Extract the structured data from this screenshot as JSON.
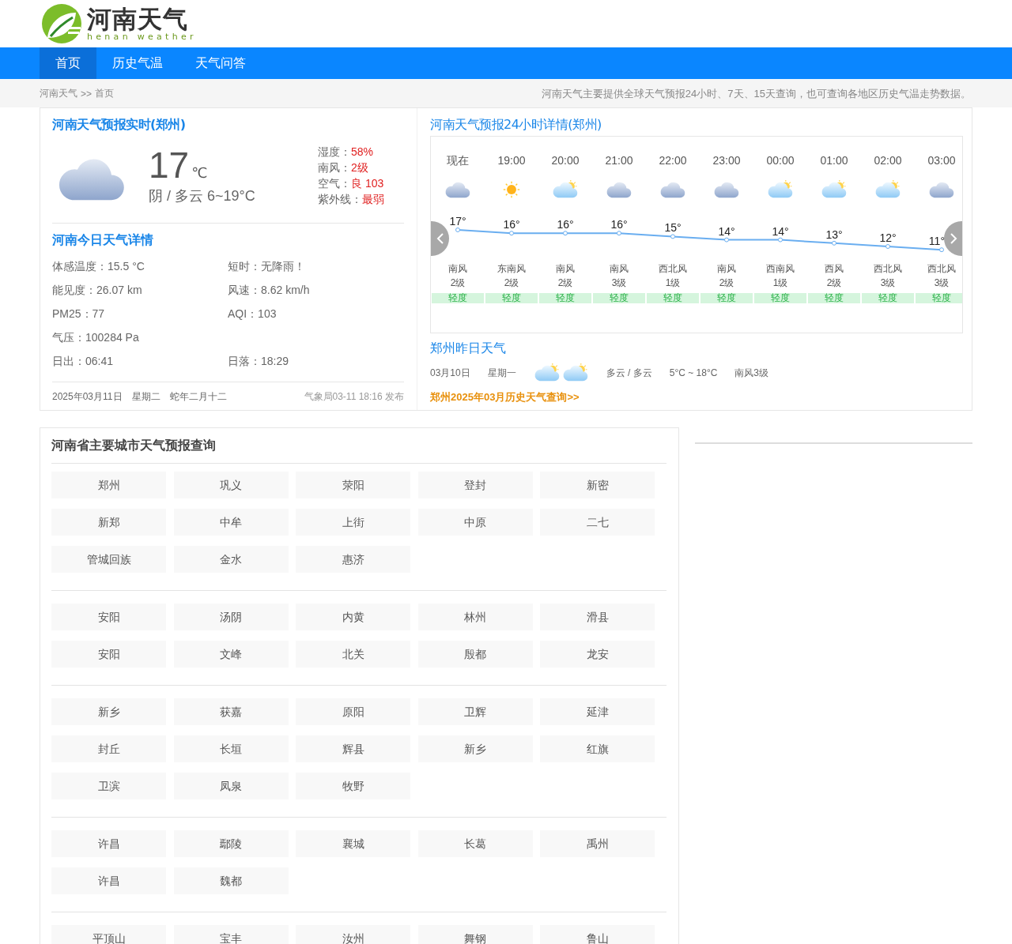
{
  "logo": {
    "title": "河南天气",
    "subtitle": "henan weather"
  },
  "nav": [
    {
      "label": "首页",
      "selected": true
    },
    {
      "label": "历史气温",
      "selected": false
    },
    {
      "label": "天气问答",
      "selected": false
    }
  ],
  "breadcrumb": {
    "links": [
      "河南天气",
      "首页"
    ],
    "separator": ">>",
    "notice": "河南天气主要提供全球天气预报24小时、7天、15天查询，也可查询各地区历史气温走势数据。"
  },
  "now": {
    "title": "河南天气预报实时(郑州)",
    "kind": "overcast",
    "temp": "17",
    "unit": "℃",
    "summary": "阴 / 多云 6~19°C",
    "stats": [
      {
        "label": "湿度：",
        "value": "58%"
      },
      {
        "label": "南风：",
        "value": "2级"
      },
      {
        "label": "空气：",
        "value": "良 103"
      },
      {
        "label": "紫外线：",
        "value": "最弱"
      }
    ]
  },
  "today": {
    "title": "河南今日天气详情",
    "rows": [
      [
        "体感温度：15.5 °C",
        "短时：无降雨！"
      ],
      [
        "能见度：26.07 km",
        "风速：8.62 km/h"
      ],
      [
        "PM25：77",
        "AQI：103"
      ],
      [
        "气压：100284 Pa"
      ],
      [
        "日出：06:41",
        "日落：18:29"
      ]
    ],
    "date_parts": [
      "2025年03月11日",
      "星期二",
      "蛇年二月十二"
    ],
    "publish": "气象局03-11 18:16 发布"
  },
  "hourly": {
    "title": "河南天气预报24小时详情(郑州)",
    "chart_data": {
      "type": "line",
      "categories": [
        "现在",
        "19:00",
        "20:00",
        "21:00",
        "22:00",
        "23:00",
        "00:00",
        "01:00",
        "02:00",
        "03:00"
      ],
      "series": [
        {
          "color": "#6aaef0",
          "marker": true,
          "values": [
            17,
            16,
            16,
            16,
            15,
            14,
            14,
            13,
            12,
            11
          ]
        }
      ],
      "data_labels": true,
      "value_labels": [
        "17°",
        "16°",
        "16°",
        "16°",
        "15°",
        "14°",
        "14°",
        "13°",
        "12°",
        "11°"
      ]
    },
    "hours": [
      {
        "kind": "overcast",
        "wind": "南风",
        "wind_level": "2级",
        "air": "轻度"
      },
      {
        "kind": "sunny",
        "wind": "东南风",
        "wind_level": "2级",
        "air": "轻度"
      },
      {
        "kind": "partly_cloudy",
        "wind": "南风",
        "wind_level": "2级",
        "air": "轻度"
      },
      {
        "kind": "overcast",
        "wind": "南风",
        "wind_level": "3级",
        "air": "轻度"
      },
      {
        "kind": "overcast",
        "wind": "西北风",
        "wind_level": "1级",
        "air": "轻度"
      },
      {
        "kind": "overcast",
        "wind": "南风",
        "wind_level": "2级",
        "air": "轻度"
      },
      {
        "kind": "partly_cloudy",
        "wind": "西南风",
        "wind_level": "1级",
        "air": "轻度"
      },
      {
        "kind": "partly_cloudy",
        "wind": "西风",
        "wind_level": "2级",
        "air": "轻度"
      },
      {
        "kind": "partly_cloudy",
        "wind": "西北风",
        "wind_level": "3级",
        "air": "轻度"
      },
      {
        "kind": "overcast",
        "wind": "西北风",
        "wind_level": "3级",
        "air": "轻度"
      }
    ]
  },
  "yesterday": {
    "title": "郑州昨日天气",
    "date": "03月10日",
    "weekday": "星期一",
    "icons": [
      {
        "kind": "partly_cloudy"
      },
      {
        "kind": "partly_cloudy"
      }
    ],
    "weather": "多云 / 多云",
    "temp": "5°C ~ 18°C",
    "wind": "南风3级"
  },
  "history_link": "郑州2025年03月历史天气查询>>",
  "cities": {
    "title": "河南省主要城市天气预报查询",
    "groups": [
      [
        "郑州",
        "巩义",
        "荥阳",
        "登封",
        "新密",
        "新郑",
        "中牟",
        "上街",
        "中原",
        "二七",
        "管城回族",
        "金水",
        "惠济"
      ],
      [
        "安阳",
        "汤阴",
        "内黄",
        "林州",
        "滑县",
        "安阳",
        "文峰",
        "北关",
        "殷都",
        "龙安"
      ],
      [
        "新乡",
        "获嘉",
        "原阳",
        "卫辉",
        "延津",
        "封丘",
        "长垣",
        "辉县",
        "新乡",
        "红旗",
        "卫滨",
        "凤泉",
        "牧野"
      ],
      [
        "许昌",
        "鄢陵",
        "襄城",
        "长葛",
        "禹州",
        "许昌",
        "魏都"
      ],
      [
        "平顶山",
        "宝丰",
        "汝州",
        "舞钢",
        "鲁山"
      ]
    ]
  }
}
